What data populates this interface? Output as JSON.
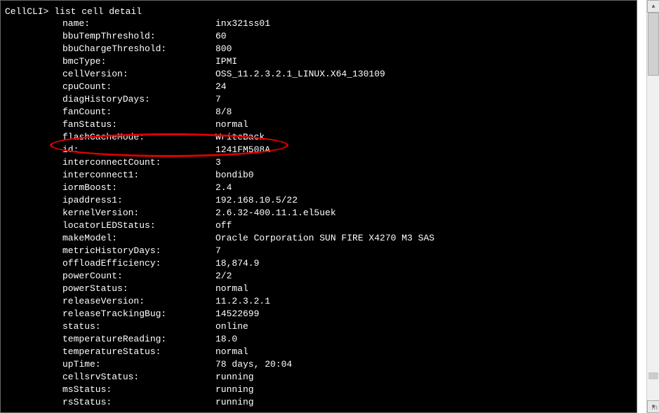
{
  "prompt": "CellCLI> ",
  "command": "list cell detail",
  "rows": [
    {
      "key": "name:",
      "value": "inx321ss01"
    },
    {
      "key": "bbuTempThreshold:",
      "value": "60"
    },
    {
      "key": "bbuChargeThreshold:",
      "value": "800"
    },
    {
      "key": "bmcType:",
      "value": "IPMI"
    },
    {
      "key": "cellVersion:",
      "value": "OSS_11.2.3.2.1_LINUX.X64_130109"
    },
    {
      "key": "cpuCount:",
      "value": "24"
    },
    {
      "key": "diagHistoryDays:",
      "value": "7"
    },
    {
      "key": "fanCount:",
      "value": "8/8"
    },
    {
      "key": "fanStatus:",
      "value": "normal"
    },
    {
      "key": "flashCacheMode:",
      "value": "WriteBack"
    },
    {
      "key": "id:",
      "value": "1241FM508A"
    },
    {
      "key": "interconnectCount:",
      "value": "3"
    },
    {
      "key": "interconnect1:",
      "value": "bondib0"
    },
    {
      "key": "iormBoost:",
      "value": "2.4"
    },
    {
      "key": "ipaddress1:",
      "value": "192.168.10.5/22"
    },
    {
      "key": "kernelVersion:",
      "value": "2.6.32-400.11.1.el5uek"
    },
    {
      "key": "locatorLEDStatus:",
      "value": "off"
    },
    {
      "key": "makeModel:",
      "value": "Oracle Corporation SUN FIRE X4270 M3 SAS"
    },
    {
      "key": "metricHistoryDays:",
      "value": "7"
    },
    {
      "key": "offloadEfficiency:",
      "value": "18,874.9"
    },
    {
      "key": "powerCount:",
      "value": "2/2"
    },
    {
      "key": "powerStatus:",
      "value": "normal"
    },
    {
      "key": "releaseVersion:",
      "value": "11.2.3.2.1"
    },
    {
      "key": "releaseTrackingBug:",
      "value": "14522699"
    },
    {
      "key": "status:",
      "value": "online"
    },
    {
      "key": "temperatureReading:",
      "value": "18.0"
    },
    {
      "key": "temperatureStatus:",
      "value": "normal"
    },
    {
      "key": "upTime:",
      "value": "78 days, 20:04"
    },
    {
      "key": "cellsrvStatus:",
      "value": "running"
    },
    {
      "key": "msStatus:",
      "value": "running"
    },
    {
      "key": "rsStatus:",
      "value": "running"
    }
  ],
  "scrollbar": {
    "up_glyph": "▲",
    "down_glyph": "▼"
  },
  "watermark": "m"
}
